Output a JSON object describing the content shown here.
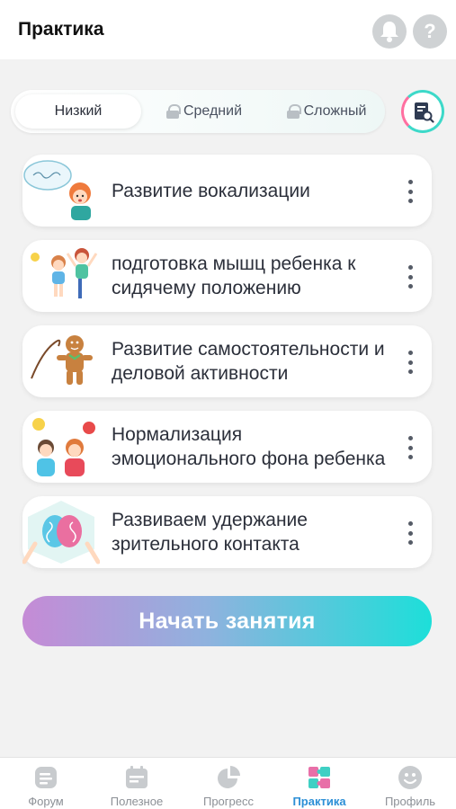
{
  "header": {
    "title": "Практика",
    "help_glyph": "?"
  },
  "levels": {
    "low": "Низкий",
    "medium": "Средний",
    "hard": "Сложный"
  },
  "exercises": [
    {
      "title": "Развитие вокализации",
      "image": "girl-singing-illustration"
    },
    {
      "title": "подготовка мышц ребенка к сидячему положению",
      "image": "kids-exercising-illustration"
    },
    {
      "title": "Развитие самостоятельности и деловой активности",
      "image": "gingerbread-illustration"
    },
    {
      "title": "Нормализация эмоционального фона ребенка",
      "image": "emotions-kids-illustration"
    },
    {
      "title": "Развиваем удержание зрительного контакта",
      "image": "brain-hands-illustration"
    }
  ],
  "start_button": "Начать занятия",
  "tabs": [
    {
      "label": "Форум",
      "icon": "forum-icon"
    },
    {
      "label": "Полезное",
      "icon": "calendar-icon"
    },
    {
      "label": "Прогресс",
      "icon": "pie-chart-icon"
    },
    {
      "label": "Практика",
      "icon": "puzzle-icon",
      "active": true
    },
    {
      "label": "Профиль",
      "icon": "smiley-icon"
    }
  ],
  "colors": {
    "accent_teal": "#1ddfd9",
    "accent_purple": "#c58bd6",
    "active_tab": "#2c8fd6",
    "inactive_icon": "#cfd2d4"
  }
}
